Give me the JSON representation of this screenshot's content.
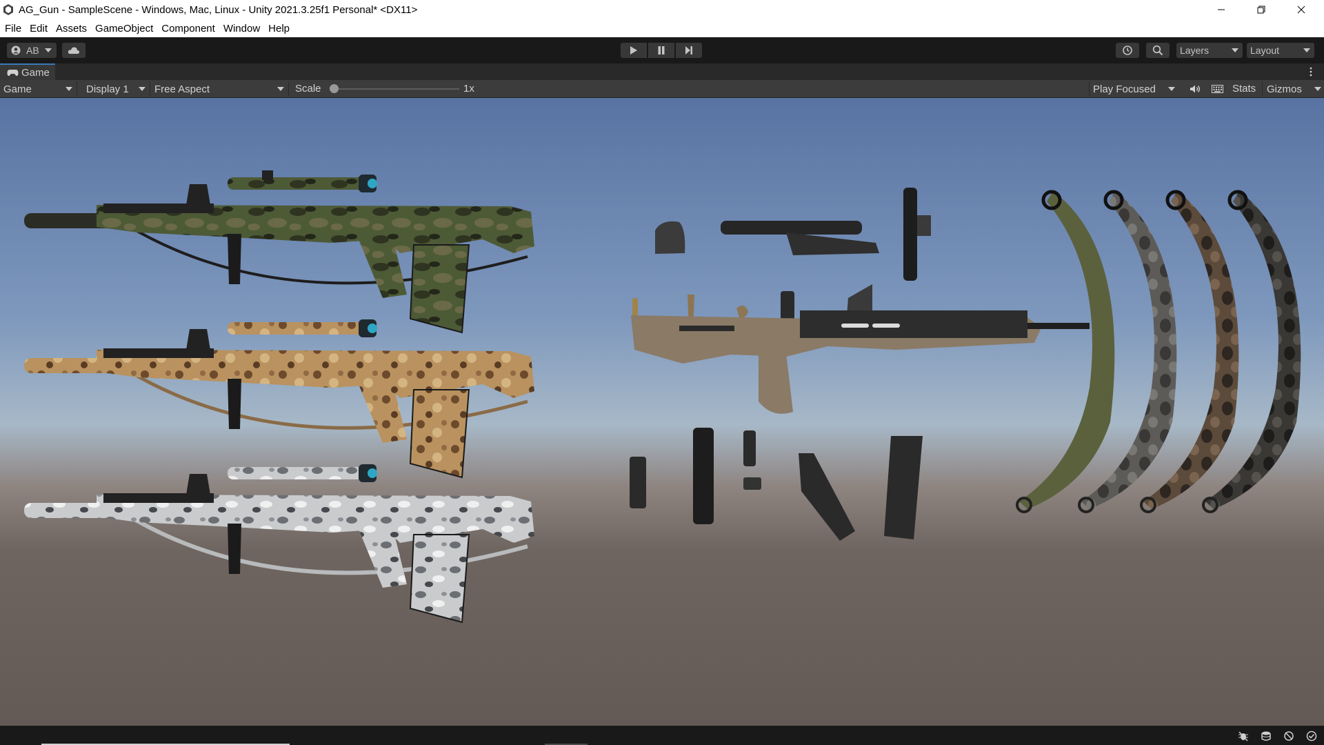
{
  "window": {
    "title": "AG_Gun - SampleScene - Windows, Mac, Linux - Unity 2021.3.25f1 Personal* <DX11>"
  },
  "menu": {
    "items": [
      "File",
      "Edit",
      "Assets",
      "GameObject",
      "Component",
      "Window",
      "Help"
    ]
  },
  "toolbar": {
    "account_label": "AB",
    "layers_label": "Layers",
    "layout_label": "Layout",
    "icons": [
      "account-icon",
      "cloud-icon",
      "play-icon",
      "pause-icon",
      "step-icon",
      "history-icon",
      "search-icon"
    ]
  },
  "game_view": {
    "tab_label": "Game",
    "view_mode": "Game",
    "display": "Display 1",
    "aspect": "Free Aspect",
    "scale_label": "Scale",
    "scale_value": "1x",
    "scale_slider_fraction": 0.0,
    "play_mode": "Play Focused",
    "stats_label": "Stats",
    "gizmos_label": "Gizmos"
  },
  "scene": {
    "rifle_variants": [
      "green-camo",
      "desert-camo",
      "snow-camo"
    ],
    "sling_variants": [
      "olive",
      "grey-camo",
      "brown-camo",
      "dark-camo"
    ],
    "colors": {
      "sky_top": "#5873a2",
      "horizon": "#a7b8c7",
      "ground": "#645a55",
      "tan_rifle": "#8a7a66"
    }
  }
}
